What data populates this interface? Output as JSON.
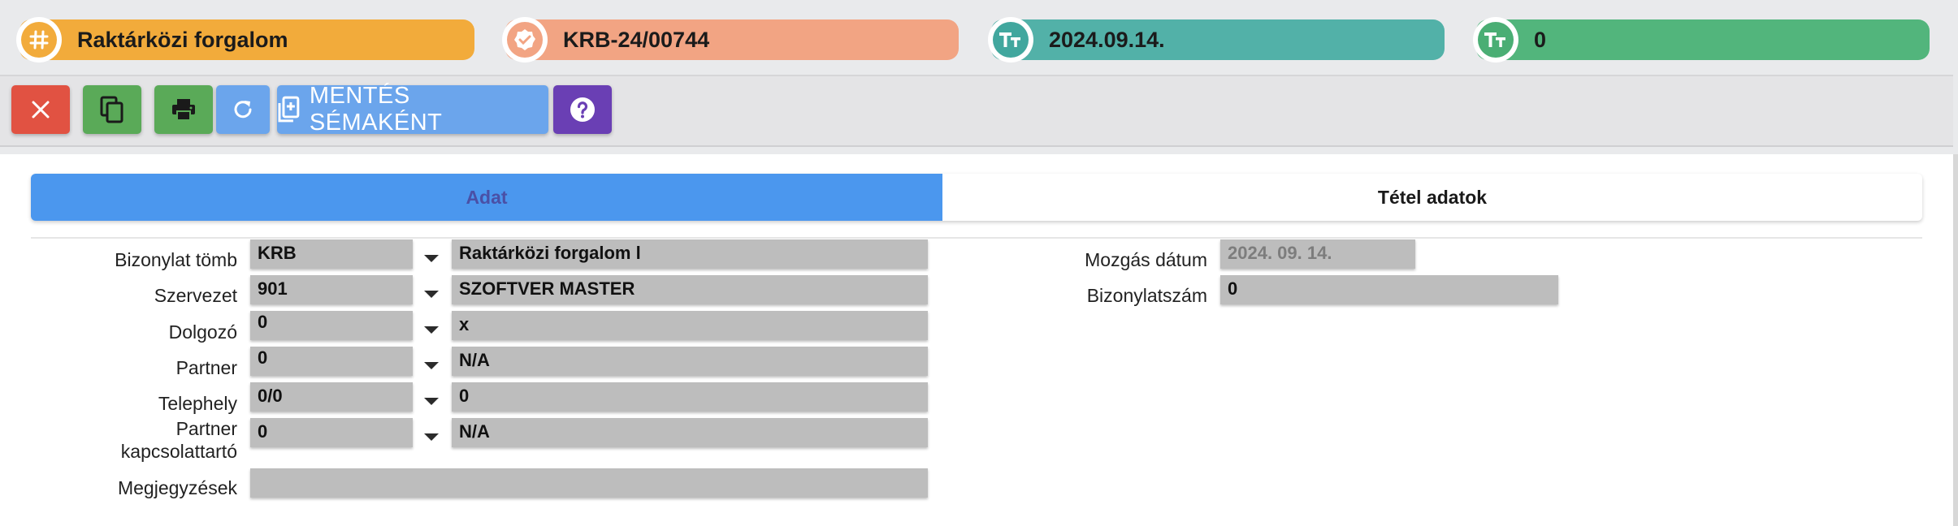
{
  "header": {
    "pills": [
      {
        "text": "Raktárközi forgalom",
        "icon": "hash-icon",
        "color": "#f2ab3b",
        "icon_color": "#f2ab3b"
      },
      {
        "text": "KRB-24/00744",
        "icon": "badge-check-icon",
        "color": "#f2a483",
        "icon_color": "#f2a483"
      },
      {
        "text": "2024.09.14.",
        "icon": "text-size-icon",
        "color": "#52b1a8",
        "icon_color": "#41a79e"
      },
      {
        "text": "0",
        "icon": "text-size-icon",
        "color": "#52b57c",
        "icon_color": "#4aae74"
      }
    ]
  },
  "toolbar": {
    "close_icon": "close-icon",
    "copy_icon": "copy-icon",
    "print_icon": "print-icon",
    "refresh_icon": "refresh-icon",
    "save_template_label": "MENTÉS SÉMAKÉNT",
    "help_icon": "help-icon",
    "colors": {
      "close": "#e15242",
      "copy": "#5aaa58",
      "print": "#5aaa58",
      "refresh": "#6ba5ec",
      "save": "#6ba5ec",
      "help": "#6a3fb4"
    }
  },
  "tabs": [
    {
      "label": "Adat",
      "active": true
    },
    {
      "label": "Tétel adatok",
      "active": false
    }
  ],
  "form": {
    "left": [
      {
        "label": "Bizonylat tömb",
        "code": "KRB",
        "name": "Raktárközi forgalom l"
      },
      {
        "label": "Szervezet",
        "code": "901",
        "name": "SZOFTVER MASTER"
      },
      {
        "label": "Dolgozó",
        "code": "0",
        "name": "x"
      },
      {
        "label": "Partner",
        "code": "0",
        "name": "N/A"
      },
      {
        "label": "Telephely",
        "code": "0/0",
        "name": "0"
      },
      {
        "label_line1": "Partner",
        "label_line2": "kapcsolattartó",
        "code": "0",
        "name": "N/A"
      },
      {
        "label": "Megjegyzések",
        "value": ""
      }
    ],
    "right": [
      {
        "label": "Mozgás dátum",
        "value": "2024. 09. 14."
      },
      {
        "label": "Bizonylatszám",
        "value": "0"
      }
    ]
  }
}
